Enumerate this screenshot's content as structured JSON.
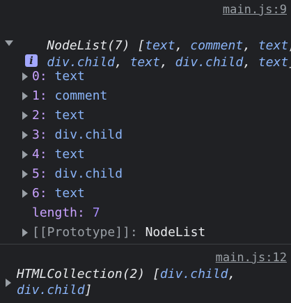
{
  "log1": {
    "source": "main.js:9",
    "summary_prefix": "NodeList(7) [",
    "summary_line1_items": [
      "text",
      "comment",
      "text"
    ],
    "summary_line2_items": [
      "div.child",
      "text",
      "div.child",
      "text"
    ],
    "info_icon_glyph": "i",
    "entries": [
      {
        "index": "0",
        "value": "text"
      },
      {
        "index": "1",
        "value": "comment"
      },
      {
        "index": "2",
        "value": "text"
      },
      {
        "index": "3",
        "value": "div.child"
      },
      {
        "index": "4",
        "value": "text"
      },
      {
        "index": "5",
        "value": "div.child"
      },
      {
        "index": "6",
        "value": "text"
      }
    ],
    "length_label": "length",
    "length_value": "7",
    "prototype_label": "[[Prototype]]",
    "prototype_value": "NodeList"
  },
  "log2": {
    "source": "main.js:12",
    "summary_prefix": "HTMLCollection(2) [",
    "items": [
      "div.child",
      "div.child"
    ]
  },
  "colors": {
    "background": "#202124",
    "link": "#9aa0a6",
    "value_blue": "#8ab4f8",
    "number_purple": "#a78bfa"
  }
}
